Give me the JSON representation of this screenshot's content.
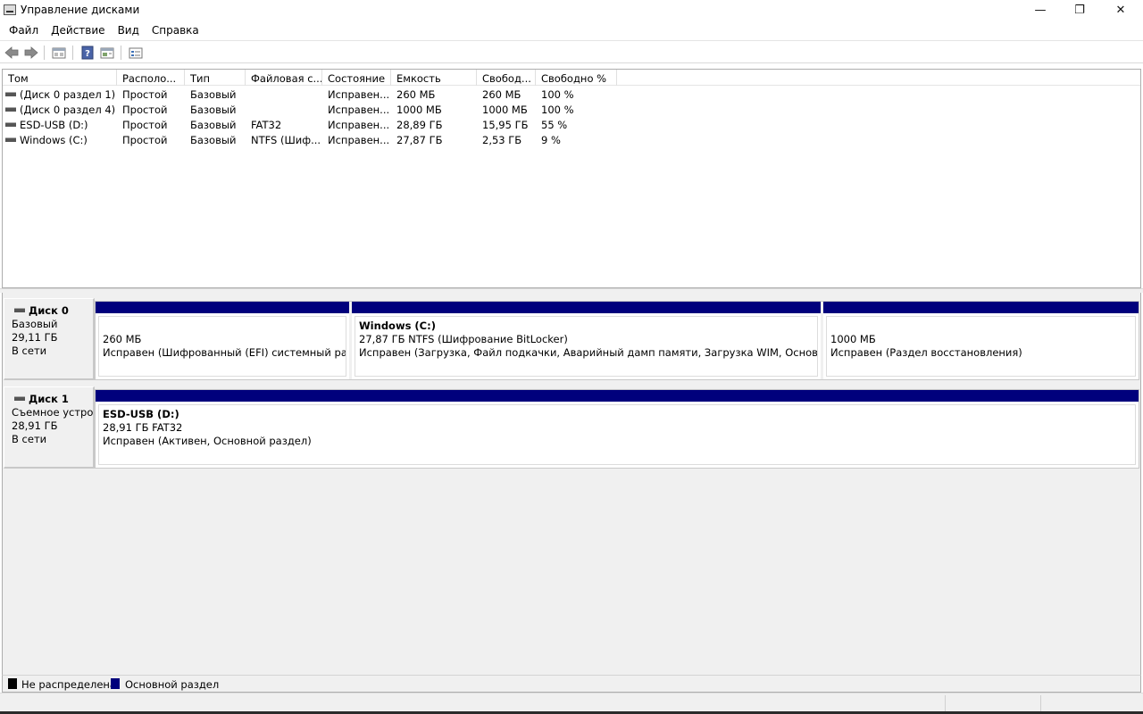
{
  "window": {
    "title": "Управление дисками",
    "minimize_glyph": "—",
    "maximize_glyph": "❐",
    "close_glyph": "✕"
  },
  "menu": [
    "Файл",
    "Действие",
    "Вид",
    "Справка"
  ],
  "toolbar": [
    "back-icon",
    "forward-icon",
    "properties-icon",
    "help-icon",
    "refresh-icon",
    "settings-icon"
  ],
  "volumes": {
    "columns": [
      "Том",
      "Располо...",
      "Тип",
      "Файловая с...",
      "Состояние",
      "Емкость",
      "Свобод...",
      "Свободно %"
    ],
    "rows": [
      [
        "(Диск 0 раздел 1)",
        "Простой",
        "Базовый",
        "",
        "Исправен...",
        "260 МБ",
        "260 МБ",
        "100 %"
      ],
      [
        "(Диск 0 раздел 4)",
        "Простой",
        "Базовый",
        "",
        "Исправен...",
        "1000 МБ",
        "1000 МБ",
        "100 %"
      ],
      [
        "ESD-USB (D:)",
        "Простой",
        "Базовый",
        "FAT32",
        "Исправен...",
        "28,89 ГБ",
        "15,95 ГБ",
        "55 %"
      ],
      [
        "Windows (C:)",
        "Простой",
        "Базовый",
        "NTFS (Шиф...",
        "Исправен...",
        "27,87 ГБ",
        "2,53 ГБ",
        "9 %"
      ]
    ]
  },
  "disks": [
    {
      "name": "Диск 0",
      "type": "Базовый",
      "size": "29,11 ГБ",
      "status": "В сети",
      "partitions": [
        {
          "name": "",
          "size": "260 МБ",
          "status": "Исправен (Шифрованный (EFI) системный раздел)"
        },
        {
          "name": "Windows  (C:)",
          "size": "27,87 ГБ NTFS (Шифрование BitLocker)",
          "status": "Исправен (Загрузка, Файл подкачки, Аварийный дамп памяти, Загрузка WIM, Основной раздел)"
        },
        {
          "name": "",
          "size": "1000 МБ",
          "status": "Исправен (Раздел восстановления)"
        }
      ]
    },
    {
      "name": "Диск 1",
      "type": "Съемное устройство",
      "size": "28,91 ГБ",
      "status": "В сети",
      "partitions": [
        {
          "name": "ESD-USB  (D:)",
          "size": "28,91 ГБ FAT32",
          "status": "Исправен (Активен, Основной раздел)"
        }
      ]
    }
  ],
  "legend": [
    {
      "label": "Не распределена",
      "color": "#000000"
    },
    {
      "label": "Основной раздел",
      "color": "#00007c"
    }
  ]
}
